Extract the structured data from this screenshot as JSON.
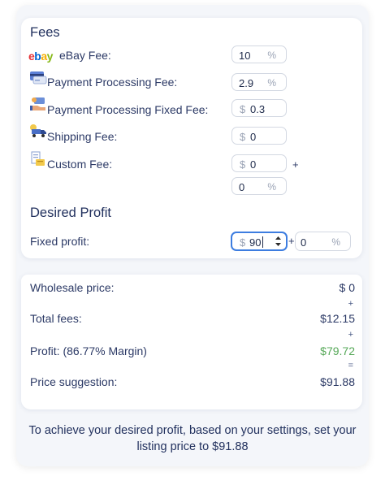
{
  "fees": {
    "title": "Fees",
    "ebay": {
      "label": "eBay Fee:",
      "value": "10",
      "suffix": "%"
    },
    "payment": {
      "label": "Payment Processing Fee:",
      "value": "2.9",
      "suffix": "%"
    },
    "fixed": {
      "label": "Payment Processing Fixed Fee:",
      "prefix": "$",
      "value": "0.3"
    },
    "shipping": {
      "label": "Shipping Fee:",
      "prefix": "$",
      "value": "0"
    },
    "custom": {
      "label": "Custom Fee:",
      "prefix": "$",
      "value": "0",
      "plus": "+",
      "percent_value": "0",
      "percent_suffix": "%"
    },
    "ebay_logo": "ebay"
  },
  "profit": {
    "title": "Desired Profit",
    "label": "Fixed profit:",
    "prefix": "$",
    "value": "90",
    "plus": "+",
    "percent_value": "0",
    "percent_suffix": "%"
  },
  "summary": {
    "wholesale_label": "Wholesale price:",
    "wholesale_value": "$ 0",
    "op1": "+",
    "fees_label": "Total fees:",
    "fees_value": "$12.15",
    "op2": "+",
    "profit_label": "Profit: (86.77% Margin)",
    "profit_value": "$79.72",
    "op3": "=",
    "suggestion_label": "Price suggestion:",
    "suggestion_value": "$91.88"
  },
  "footer": {
    "line1": "To achieve your desired profit, based on your settings, set your",
    "line2": "listing price to $91.88"
  },
  "colors": {
    "accent_green": "#56a858",
    "focus_blue": "#3d7de0",
    "text": "#2c3a66"
  }
}
